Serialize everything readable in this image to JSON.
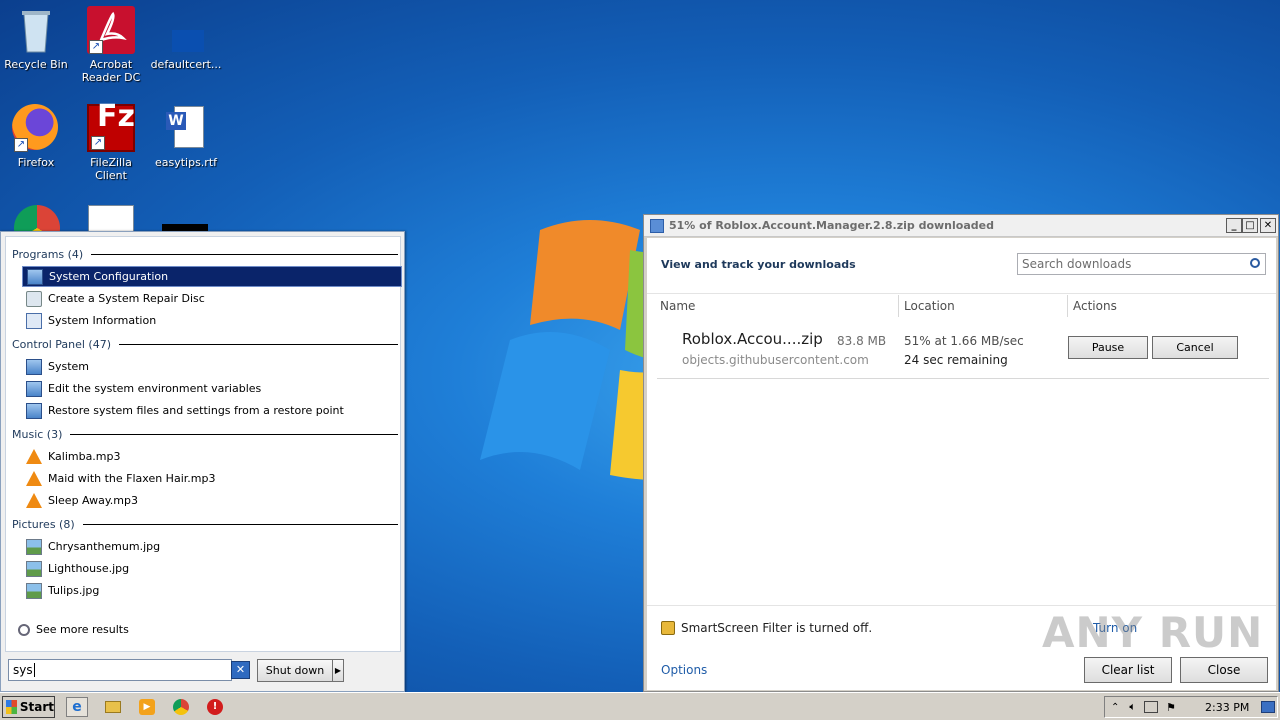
{
  "desktop": {
    "icons": [
      {
        "label": "Recycle Bin",
        "icon": "recycle-bin-icon"
      },
      {
        "label": "Acrobat Reader DC",
        "icon": "acrobat-icon"
      },
      {
        "label": "defaultcert...",
        "icon": "file-icon"
      },
      {
        "label": "Firefox",
        "icon": "firefox-icon"
      },
      {
        "label": "FileZilla Client",
        "icon": "filezilla-icon"
      },
      {
        "label": "easytips.rtf",
        "icon": "word-document-icon"
      }
    ]
  },
  "start_menu": {
    "sections": [
      {
        "header": "Programs (4)",
        "items": [
          "System Configuration",
          "Create a System Repair Disc",
          "System Information"
        ]
      },
      {
        "header": "Control Panel (47)",
        "items": [
          "System",
          "Edit the system environment variables",
          "Restore system files and settings from a restore point"
        ]
      },
      {
        "header": "Music (3)",
        "items": [
          "Kalimba.mp3",
          "Maid with the Flaxen Hair.mp3",
          "Sleep Away.mp3"
        ]
      },
      {
        "header": "Pictures (8)",
        "items": [
          "Chrysanthemum.jpg",
          "Lighthouse.jpg",
          "Tulips.jpg"
        ]
      }
    ],
    "see_more": "See more results",
    "search_value": "sys",
    "shutdown_label": "Shut down",
    "selected_item": "System Configuration"
  },
  "downloads": {
    "title": "51% of Roblox.Account.Manager.2.8.zip downloaded",
    "heading": "View and track your downloads",
    "search_placeholder": "Search downloads",
    "columns": {
      "name": "Name",
      "location": "Location",
      "actions": "Actions"
    },
    "item": {
      "file_name": "Roblox.Accou....zip",
      "size": "83.8 MB",
      "source": "objects.githubusercontent.com",
      "progress": "51% at 1.66 MB/sec",
      "remaining": "24 sec remaining",
      "pause_label": "Pause",
      "cancel_label": "Cancel"
    },
    "smartscreen": "SmartScreen Filter is turned off.",
    "turn_on": "Turn on",
    "options": "Options",
    "clear_list": "Clear list",
    "close": "Close"
  },
  "taskbar": {
    "start_label": "Start",
    "clock": "2:33 PM"
  },
  "watermark": "ANY RUN"
}
